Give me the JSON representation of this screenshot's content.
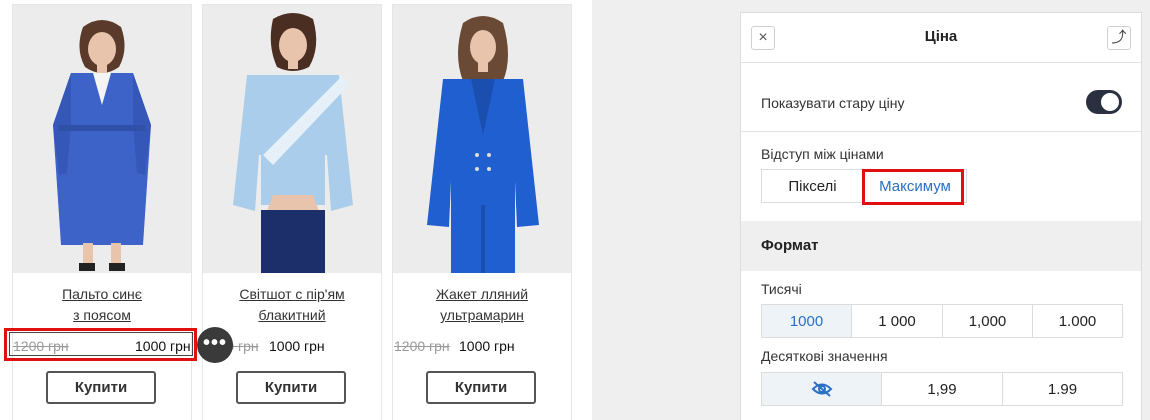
{
  "products": [
    {
      "title_line1": "Пальто синє",
      "title_line2": "з поясом",
      "old_price": "1200 грн",
      "price": "1000 грн",
      "buy_label": "Купити"
    },
    {
      "title_line1": "Світшот с пір'ям",
      "title_line2": "блакитний",
      "old_price": "1200 грн",
      "price": "1000 грн",
      "buy_label": "Купити"
    },
    {
      "title_line1": "Жакет лляний",
      "title_line2": "ультрамарин",
      "old_price": "1200 грн",
      "price": "1000 грн",
      "buy_label": "Купити"
    }
  ],
  "more_button": "•••",
  "panel": {
    "title": "Ціна",
    "close_icon": "×",
    "back_icon": "⤴",
    "show_old_price_label": "Показувати стару ціну",
    "show_old_price": true,
    "spacing_label": "Відступ між цінами",
    "spacing_options": [
      "Пікселі",
      "Максимум"
    ],
    "spacing_selected": "Максимум",
    "format_title": "Формат",
    "thousands_label": "Тисячі",
    "thousands_options": [
      "1000",
      "1 000",
      "1,000",
      "1.000"
    ],
    "thousands_selected": "1000",
    "decimals_label": "Десяткові значення",
    "decimals_options": [
      "hidden-eye-icon",
      "1,99",
      "1.99"
    ]
  },
  "colors": {
    "accent_blue": "#2a6fc4",
    "highlight_red": "#e01010",
    "toggle_dark": "#2a3040"
  }
}
